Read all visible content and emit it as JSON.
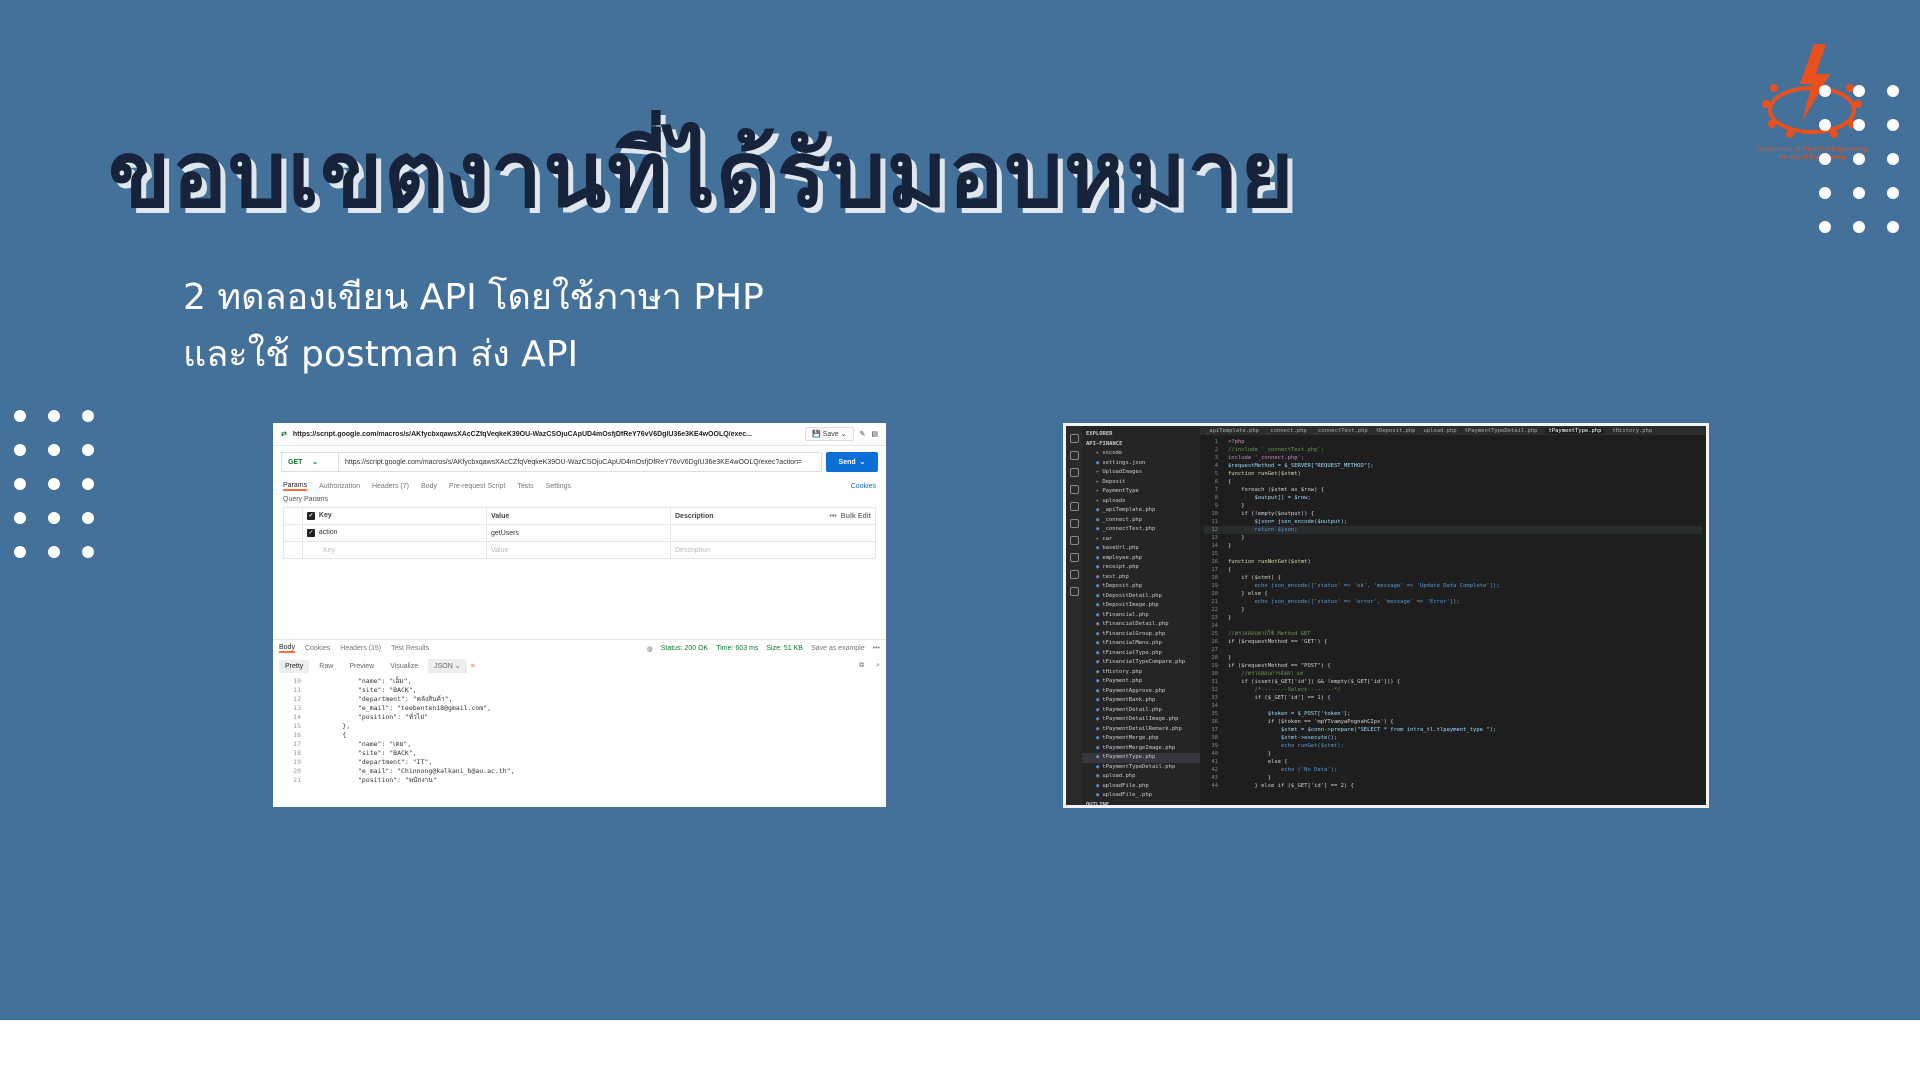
{
  "slide": {
    "title": "ขอบเขตงานที่ได้รับมอบหมาย",
    "lines": [
      "2 ทดลองเขียน API โดยใช้ภาษา PHP",
      "และใช้ postman ส่ง API"
    ],
    "logo_text": [
      "Department of Electrical Engineering",
      "Faculty of Engineering"
    ],
    "colors": {
      "background": "#44719a",
      "title": "#16233a",
      "accent": "#e8501e"
    }
  },
  "postman": {
    "request_name": "https://script.google.com/macros/s/AKfycbxqawsXAcCZfqVeqkeK39OU-WazCSOjuCApUD4mOsfjDfReY76vV6DgIU36e3KE4wOOLQ/exec...",
    "save_label": "Save",
    "method": "GET",
    "url": "https://script.google.com/macros/s/AKfycbxqawsXAcCZfqVeqkeK39OU-WazCSOjuCApUD4mOsfjDfReY76vV6DgIU36e3KE4wOOLQ/exec?action=",
    "send_label": "Send",
    "tabs": [
      "Params",
      "Authorization",
      "Headers (7)",
      "Body",
      "Pre-request Script",
      "Tests",
      "Settings"
    ],
    "cookies_label": "Cookies",
    "query_params_label": "Query Params",
    "table": {
      "headers": [
        "Key",
        "Value",
        "Description",
        "Bulk Edit"
      ],
      "rows": [
        {
          "key": "action",
          "value": "getUsers"
        }
      ],
      "placeholder": {
        "key": "Key",
        "value": "Value",
        "description": "Description"
      }
    },
    "response": {
      "tabs": [
        "Body",
        "Cookies",
        "Headers (15)",
        "Test Results"
      ],
      "status": "Status: 200 OK",
      "time": "Time: 603 ms",
      "size": "Size: 51 KB",
      "save_example": "Save as example",
      "views": [
        "Pretty",
        "Raw",
        "Preview",
        "Visualize"
      ],
      "format": "JSON",
      "code_lines": [
        {
          "n": "10",
          "t": "            \"name\": \"เอ็ม\","
        },
        {
          "n": "11",
          "t": "            \"site\": \"BACK\","
        },
        {
          "n": "12",
          "t": "            \"department\": \"คลังสินค้า\","
        },
        {
          "n": "13",
          "t": "            \"e_mail\": \"teebenten18@gmail.com\","
        },
        {
          "n": "14",
          "t": "            \"position\": \"ทั่วไป\""
        },
        {
          "n": "15",
          "t": "        },"
        },
        {
          "n": "16",
          "t": "        {"
        },
        {
          "n": "17",
          "t": "            \"name\": \"เตย\","
        },
        {
          "n": "18",
          "t": "            \"site\": \"BACK\","
        },
        {
          "n": "19",
          "t": "            \"department\": \"IT\","
        },
        {
          "n": "20",
          "t": "            \"e_mail\": \"Chinnong@kalkani_b@au.ac.th\","
        },
        {
          "n": "21",
          "t": "            \"position\": \"พนักงาน\""
        }
      ]
    }
  },
  "vscode": {
    "tabs": [
      "_apiTemplate.php",
      "_connect.php",
      "_connectTest.php",
      "tDeposit.php",
      "upload.php",
      "tPaymentTypeDetail.php",
      "tPaymentType.php",
      "tHistory.php"
    ],
    "files": [
      "EXPLORER",
      "API-FINANCE",
      "vscode",
      "settings.json",
      "UploadImages",
      "Deposit",
      "PaymentType",
      "uploads",
      "_apiTemplate.php",
      "_connect.php",
      "_connectTest.php",
      "car",
      "baseUrl.php",
      "employee.php",
      "receipt.php",
      "test.php",
      "tDeposit.php",
      "tDepositDetail.php",
      "tDepositImage.php",
      "tFinancial.php",
      "tFinancialDetail.php",
      "tFinancialGroup.php",
      "tFinancialMenu.php",
      "tFinancialType.php",
      "tFinancialTypeCompare.php",
      "tHistory.php",
      "tPayment.php",
      "tPaymentApprove.php",
      "tPaymentBank.php",
      "tPaymentDetail.php",
      "tPaymentDetailImage.php",
      "tPaymentDetailRemark.php",
      "tPaymentMerge.php",
      "tPaymentMergeImage.php",
      "tPaymentType.php",
      "tPaymentTypeDetail.php",
      "upload.php",
      "uploadFile.php",
      "uploadFile_.php",
      "OUTLINE",
      "TIMELINE"
    ],
    "code": [
      {
        "n": "1",
        "t": "<?php"
      },
      {
        "n": "2",
        "t": "//include '_connectTest.php';"
      },
      {
        "n": "3",
        "t": "include '_connect.php';"
      },
      {
        "n": "4",
        "t": "$requestMethod = $_SERVER[\"REQUEST_METHOD\"];"
      },
      {
        "n": "5",
        "t": "function runGet($stmt)"
      },
      {
        "n": "6",
        "t": "{"
      },
      {
        "n": "7",
        "t": "    foreach ($stmt as $row) {"
      },
      {
        "n": "8",
        "t": "        $output[] = $row;"
      },
      {
        "n": "9",
        "t": "    }"
      },
      {
        "n": "10",
        "t": "    if (!empty($output)) {"
      },
      {
        "n": "11",
        "t": "        $json= json_encode($output);"
      },
      {
        "n": "12",
        "t": "        return $json;"
      },
      {
        "n": "13",
        "t": "    }"
      },
      {
        "n": "14",
        "t": "}"
      },
      {
        "n": "15",
        "t": ""
      },
      {
        "n": "16",
        "t": "function runNotGet($stmt)"
      },
      {
        "n": "17",
        "t": "{"
      },
      {
        "n": "18",
        "t": "    if ($stmt) {"
      },
      {
        "n": "19",
        "t": "        echo json_encode(['status' => 'ok', 'message' => 'Update Data Complete']);"
      },
      {
        "n": "20",
        "t": "    } else {"
      },
      {
        "n": "21",
        "t": "        echo json_encode(['status' => 'error', 'message' => 'Error']);"
      },
      {
        "n": "22",
        "t": "    }"
      },
      {
        "n": "23",
        "t": "}"
      },
      {
        "n": "24",
        "t": ""
      },
      {
        "n": "25",
        "t": "//ตรวจสอบหากใช้ Method GET"
      },
      {
        "n": "26",
        "t": "if ($requestMethod == 'GET') {"
      },
      {
        "n": "27",
        "t": ""
      },
      {
        "n": "28",
        "t": "}"
      },
      {
        "n": "29",
        "t": "if ($requestMethod == \"POST\") {"
      },
      {
        "n": "30",
        "t": "    //ตรวจสอบการส่งค่า id"
      },
      {
        "n": "31",
        "t": "    if (isset($_GET['id']) && !empty($_GET['id'])) {"
      },
      {
        "n": "32",
        "t": "        /*--------Select--------*/"
      },
      {
        "n": "33",
        "t": "        if ($_GET['id'] == 1) {"
      },
      {
        "n": "34",
        "t": ""
      },
      {
        "n": "35",
        "t": "            $token = $_POST['token'];"
      },
      {
        "n": "36",
        "t": "            if ($token == 'mpYTvamyaPognahCIps') {"
      },
      {
        "n": "37",
        "t": "                $stmt = $conn->prepare(\"SELECT * from intra_tl.tlpayment_type \");"
      },
      {
        "n": "38",
        "t": "                $stmt->execute();"
      },
      {
        "n": "39",
        "t": "                echo runGet($stmt);"
      },
      {
        "n": "40",
        "t": "            }"
      },
      {
        "n": "41",
        "t": "            else {"
      },
      {
        "n": "42",
        "t": "                echo ('No Data');"
      },
      {
        "n": "43",
        "t": "            }"
      },
      {
        "n": "44",
        "t": "        } else if ($_GET['id'] == 2) {"
      }
    ]
  }
}
